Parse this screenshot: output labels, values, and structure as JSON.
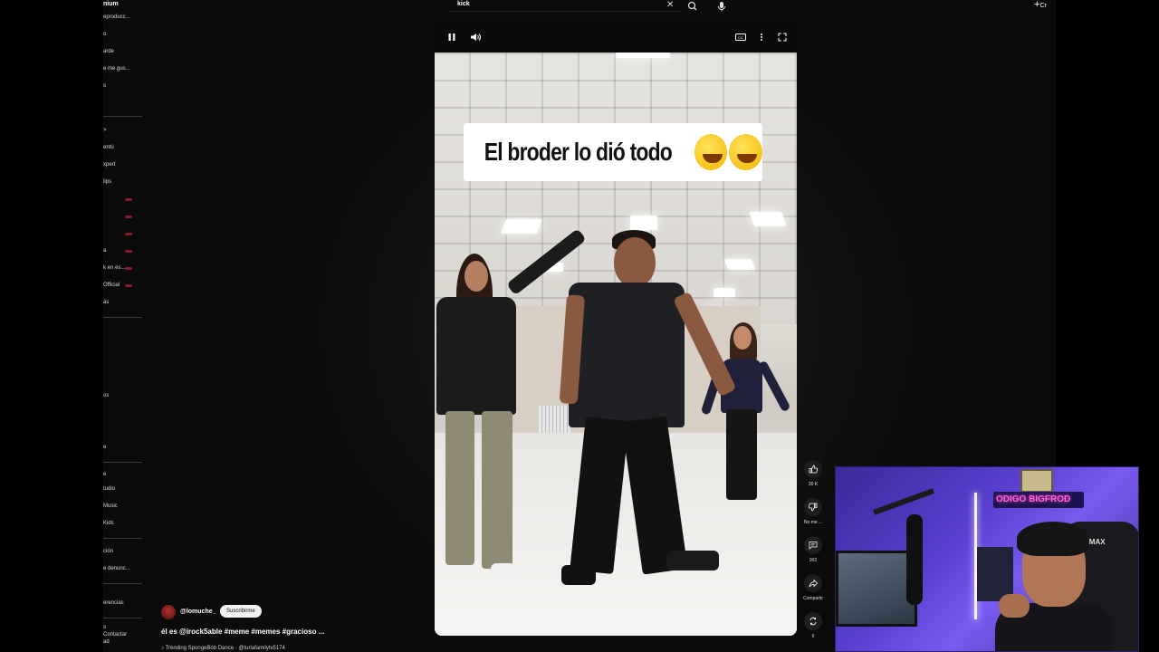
{
  "header": {
    "search_value": "kick",
    "create_label": "Cr",
    "clear_icon": "close-icon",
    "search_icon": "search-icon",
    "mic_icon": "mic-icon"
  },
  "sidebar": {
    "items": [
      {
        "label": "nium",
        "bold": true
      },
      {
        "label": "eproducc..."
      },
      {
        "label": "o"
      },
      {
        "label": "arde"
      },
      {
        "label": "e me gus..."
      },
      {
        "label": "s"
      },
      {
        "label": ">"
      },
      {
        "label": "entú"
      },
      {
        "label": "xpert"
      },
      {
        "label": "lips"
      },
      {
        "label": ""
      },
      {
        "label": ""
      },
      {
        "label": ""
      },
      {
        "label": "a"
      },
      {
        "label": "k en es..."
      },
      {
        "label": "Official"
      },
      {
        "label": "ás"
      },
      {
        "label": "os"
      },
      {
        "label": "e"
      },
      {
        "label": "e"
      },
      {
        "label": "tudio"
      },
      {
        "label": "Music"
      },
      {
        "label": "Kids"
      },
      {
        "label": "ción"
      },
      {
        "label": "e denunc..."
      },
      {
        "label": "erencias"
      },
      {
        "label": "s"
      },
      {
        "label": "Contactar"
      },
      {
        "label": "ad"
      }
    ]
  },
  "player": {
    "pause_icon": "pause-icon",
    "volume_icon": "volume-icon",
    "cc_icon": "captions-icon",
    "more_icon": "more-vert-icon",
    "fullscreen_icon": "fullscreen-icon",
    "caption_text": "El broder lo dió todo"
  },
  "actions": {
    "like_count": "39 K",
    "dislike_label": "No me ...",
    "comments_count": "902",
    "share_label": "Compartir",
    "remix_count": "6"
  },
  "meta": {
    "channel": "@lomuche_",
    "subscribe_label": "Suscribirme",
    "title": "él es @irock5able  #meme #memes #gracioso ...",
    "music": "♪ Trending SpongeBob Dance · @turlafamilytv5174"
  },
  "webcam": {
    "sign_text": "ODIGO BIGFROD",
    "chair_brand": "DMAX"
  },
  "colors": {
    "background": "#0b0b0b",
    "subscribe_bg": "#f1f1f1",
    "sidebar_accent": "#8b1a2a",
    "webcam_purple": "#5a3fd0",
    "neon_pink": "#ff6ad5"
  }
}
